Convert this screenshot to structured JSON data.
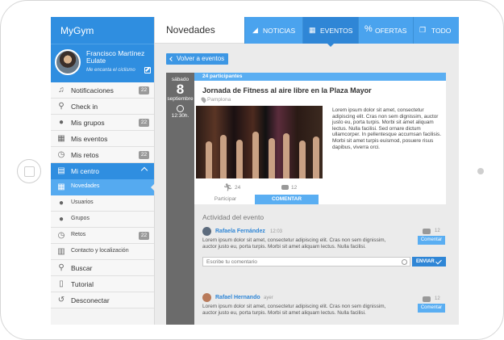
{
  "app": {
    "name": "MyGym"
  },
  "profile": {
    "name": "Francisco Martínez Eulate",
    "bio": "Me encanta el ciclismo"
  },
  "sidebar": {
    "items": [
      {
        "label": "Notificaciones",
        "icon": "bell-icon",
        "badge": "22"
      },
      {
        "label": "Check in",
        "icon": "pin-icon",
        "badge": ""
      },
      {
        "label": "Mis grupos",
        "icon": "group-icon",
        "badge": "22"
      },
      {
        "label": "Mis eventos",
        "icon": "calendar-icon",
        "badge": ""
      },
      {
        "label": "Mis retos",
        "icon": "stopwatch-icon",
        "badge": "22"
      },
      {
        "label": "Mi centro",
        "icon": "building-icon",
        "badge": ""
      },
      {
        "label": "Novedades",
        "icon": "calendar-icon",
        "badge": ""
      },
      {
        "label": "Usuarios",
        "icon": "user-icon",
        "badge": ""
      },
      {
        "label": "Grupos",
        "icon": "group-icon",
        "badge": ""
      },
      {
        "label": "Retos",
        "icon": "stopwatch-icon",
        "badge": "22"
      },
      {
        "label": "Contacto y localización",
        "icon": "map-icon",
        "badge": ""
      },
      {
        "label": "Buscar",
        "icon": "search-icon",
        "badge": ""
      },
      {
        "label": "Tutorial",
        "icon": "book-icon",
        "badge": ""
      },
      {
        "label": "Desconectar",
        "icon": "logout-icon",
        "badge": ""
      }
    ]
  },
  "header": {
    "title": "Novedades",
    "tabs": [
      {
        "label": "NOTICIAS",
        "icon": "rss-icon"
      },
      {
        "label": "EVENTOS",
        "icon": "calendar-icon"
      },
      {
        "label": "OFERTAS",
        "icon": "percent-icon"
      },
      {
        "label": "TODO",
        "icon": "windows-icon"
      }
    ]
  },
  "event": {
    "back_label": "Volver a eventos",
    "day_name": "sábado",
    "day_num": "8",
    "month": "septiembre",
    "time": "12:30h.",
    "participants": "24 participantes",
    "title": "Jornada de Fitness al aire libre en la Plaza Mayor",
    "location": "Pamplona",
    "description": "Lorem ipsum dolor sit amet, consectetur adipiscing elit. Cras non sem dignissim, auctor justo eu, porta turpis. Morbi sit amet aliquam lectus. Nulla facilisi. Sed ornare dictum ullamcorper. In pellentesque accumsan facilisis. Morbi sit amet turpis euismod, posuere risus dapibus, viverra orci.",
    "participants_count": "24",
    "comments_count": "12",
    "participate_label": "Participar",
    "comment_label": "COMENTAR"
  },
  "activity": {
    "title": "Actividad del evento",
    "posts": [
      {
        "author": "Rafaela Fernández",
        "time": "12:03",
        "text": "Lorem ipsum dolor sit amet, consectetur adipiscing elit. Cras non sem dignissim, auctor justo eu, porta turpis. Morbi sit amet aliquam lectus. Nulla facilisi.",
        "count": "12",
        "button": "Comentar"
      },
      {
        "author": "Rafael Hernando",
        "time": "ayer",
        "text": "Lorem ipsum dolor sit amet, consectetur adipiscing elit. Cras non sem dignissim, auctor justo eu, porta turpis. Morbi sit amet aliquam lectus. Nulla facilisi.",
        "count": "12",
        "button": "Comentar"
      }
    ],
    "input_placeholder": "Escribe tu comentario",
    "send_label": "ENVIAR"
  },
  "colors": {
    "primary": "#2f8ee0",
    "light": "#5aaef2",
    "dark": "#2f86d6"
  }
}
